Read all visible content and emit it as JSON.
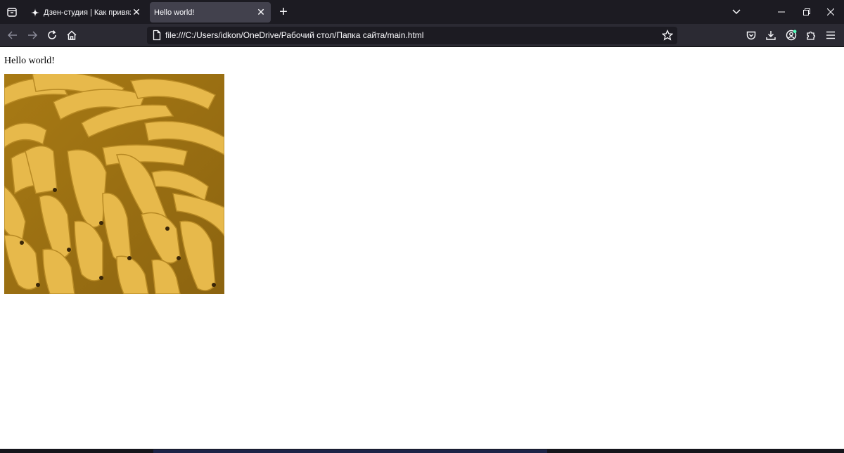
{
  "browser": {
    "tabs": [
      {
        "title": "Дзен-студия | Как привязать С",
        "favicon": "dzen-star-icon",
        "active": false
      },
      {
        "title": "Hello world!",
        "favicon": "",
        "active": true
      }
    ],
    "url": "file:///C:/Users/idkon/OneDrive/Рабочий стол/Папка сайта/main.html",
    "accent_badge_color": "#54ffbd"
  },
  "colors": {
    "tabbar_bg": "#1c1b22",
    "navbar_bg": "#2b2a33",
    "active_tab_bg": "#42414d",
    "urlbar_bg": "#1c1b22",
    "text_light": "#fbfbfe"
  },
  "page": {
    "heading": "Hello world!",
    "image": "bananas-photo"
  }
}
